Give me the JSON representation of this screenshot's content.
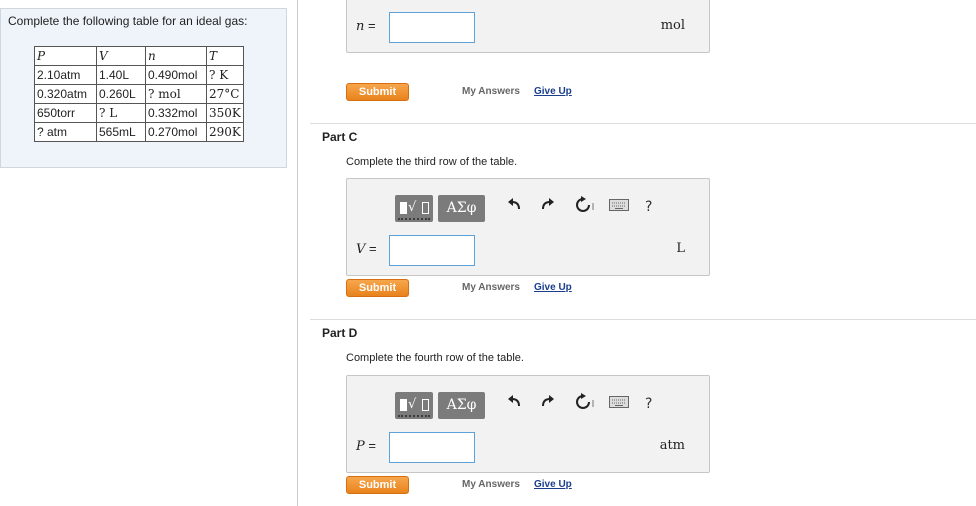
{
  "problem": {
    "prompt": "Complete the following table for an ideal gas:",
    "table": {
      "headers": [
        "P",
        "V",
        "n",
        "T"
      ],
      "rows": [
        [
          "2.10atm",
          "1.40L",
          "0.490mol",
          "? K"
        ],
        [
          "0.320atm",
          "0.260L",
          "? mol",
          "27°C"
        ],
        [
          "650torr",
          "? L",
          "0.332mol",
          "350K"
        ],
        [
          "? atm",
          "565mL",
          "0.270mol",
          "290K"
        ]
      ]
    }
  },
  "toolbar": {
    "symbols_label": "ΑΣφ",
    "templates_symbol": "√",
    "help_label": "?"
  },
  "part_b": {
    "var": "n",
    "eq": "=",
    "unit": "mol",
    "input_value": "",
    "submit_label": "Submit",
    "my_answers_label": "My Answers",
    "give_up_label": "Give Up"
  },
  "part_c": {
    "title": "Part C",
    "prompt": "Complete the third row of the table.",
    "var": "V",
    "eq": "=",
    "unit": "L",
    "input_value": "",
    "submit_label": "Submit",
    "my_answers_label": "My Answers",
    "give_up_label": "Give Up"
  },
  "part_d": {
    "title": "Part D",
    "prompt": "Complete the fourth row of the table.",
    "var": "P",
    "eq": "=",
    "unit": "atm",
    "input_value": "",
    "submit_label": "Submit",
    "my_answers_label": "My Answers",
    "give_up_label": "Give Up"
  },
  "colors": {
    "submit_orange": "#e8831c",
    "link_blue": "#1a3e8c",
    "input_border": "#5ea1d6",
    "toolbar_gray": "#7b7b7b"
  }
}
